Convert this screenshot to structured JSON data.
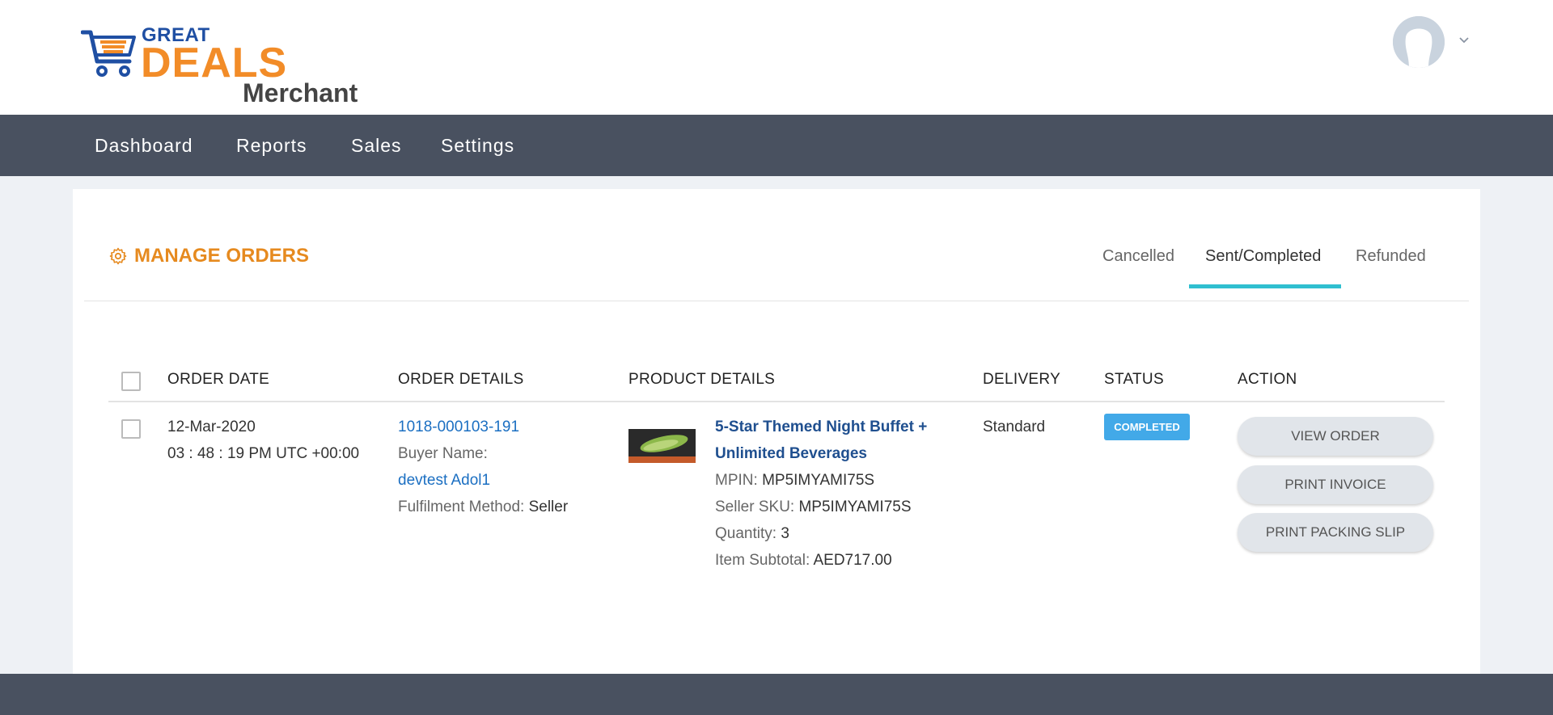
{
  "brand": {
    "great": "GREAT",
    "deals": "DEALS",
    "merchant": "Merchant"
  },
  "colors": {
    "navbar": "#495160",
    "accent": "#e68a1f",
    "tab_active": "#2fbfd0",
    "link": "#1b6fc2",
    "badge": "#42a9e8"
  },
  "nav": {
    "dashboard": "Dashboard",
    "reports": "Reports",
    "sales": "Sales",
    "settings": "Settings"
  },
  "page": {
    "title": "MANAGE ORDERS",
    "title_icon": "gear-icon"
  },
  "tabs": {
    "cancelled": "Cancelled",
    "sent_completed": "Sent/Completed",
    "refunded": "Refunded",
    "active": "Sent/Completed"
  },
  "table": {
    "headers": {
      "order_date": "ORDER DATE",
      "order_details": "ORDER DETAILS",
      "product_details": "PRODUCT DETAILS",
      "delivery": "DELIVERY",
      "status": "STATUS",
      "action": "ACTION"
    },
    "row": {
      "date": "12-Mar-2020",
      "time": "03 : 48 : 19 PM UTC +00:00",
      "order_id": "1018-000103-191",
      "buyer_label": "Buyer Name:",
      "buyer_name": "devtest Adol1",
      "fulfilment_label": "Fulfilment Method:",
      "fulfilment_value": "Seller",
      "product_name_line1": "5-Star Themed Night Buffet +",
      "product_name_line2": "Unlimited Beverages",
      "mpin_label": "MPIN:",
      "mpin": "MP5IMYAMI75S",
      "sku_label": "Seller SKU:",
      "sku": "MP5IMYAMI75S",
      "qty_label": "Quantity:",
      "qty": "3",
      "subtotal_label": "Item Subtotal:",
      "subtotal": "AED717.00",
      "delivery": "Standard",
      "status": "COMPLETED",
      "actions": {
        "view": "VIEW ORDER",
        "invoice": "PRINT INVOICE",
        "packing": "PRINT PACKING SLIP"
      }
    }
  }
}
